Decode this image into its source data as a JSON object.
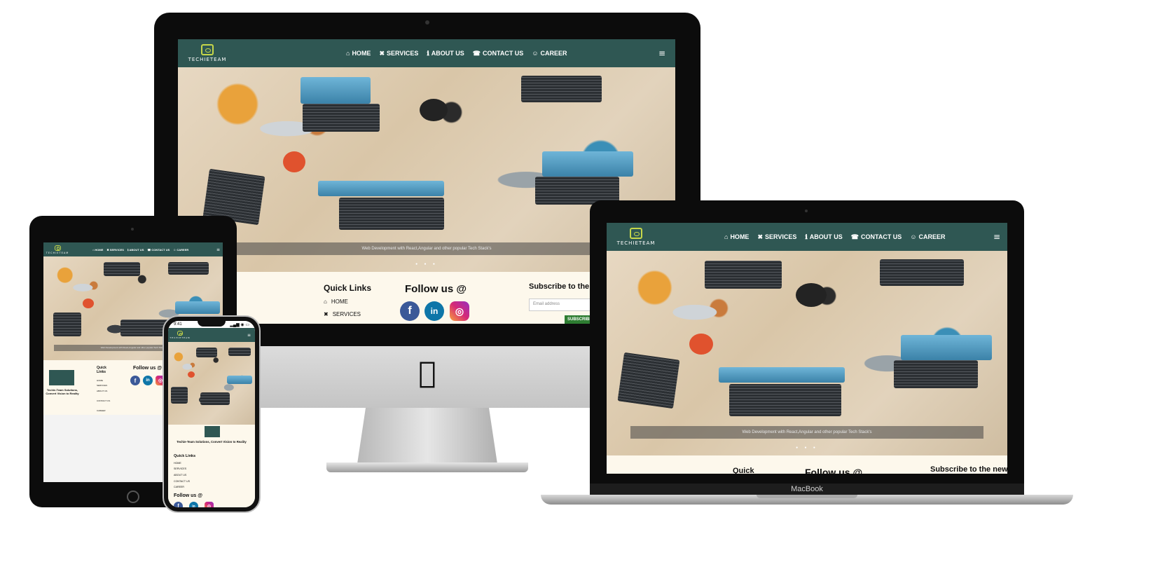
{
  "site": {
    "logo_text": "TECHIETEAM",
    "nav": [
      {
        "label": "HOME",
        "icon": "home-icon",
        "glyph": "⌂"
      },
      {
        "label": "SERVICES",
        "icon": "tools-icon",
        "glyph": "✖"
      },
      {
        "label": "ABOUT US",
        "icon": "info-icon",
        "glyph": "ℹ"
      },
      {
        "label": "CONTACT US",
        "icon": "phone-icon",
        "glyph": "☎"
      },
      {
        "label": "CAREER",
        "icon": "user-circle-icon",
        "glyph": "☺"
      }
    ],
    "menu_glyph": "≡",
    "hero_caption": "Web Development with React,Angular and other popular Tech Stack's",
    "carousel_dots": "● ● ●",
    "tagline": "Techie-Team Solutions, Convert Vision to Reality",
    "footer": {
      "quick_links_heading": "Quick Links",
      "follow_heading": "Follow us @",
      "subscribe_heading": "Subscribe to the newsletter",
      "email_placeholder": "Email address",
      "subscribe_button": "SUBSCRIBE",
      "social": [
        {
          "name": "facebook-icon",
          "glyph": "f"
        },
        {
          "name": "linkedin-icon",
          "glyph": "in"
        },
        {
          "name": "instagram-icon",
          "glyph": "◎"
        }
      ]
    }
  },
  "imac": {
    "quick_heading": "Quick Links",
    "follow_heading": "Follow us @",
    "subscribe_heading": "Subscribe to the",
    "email_placeholder": "Email address",
    "subscribe_button": "SUBSCRIBE",
    "links": [
      {
        "label": "HOME",
        "glyph": "⌂"
      },
      {
        "label": "SERVICES",
        "glyph": "✖"
      }
    ]
  },
  "macbook": {
    "quick_heading": "Quick",
    "follow_heading": "Follow us @",
    "subscribe_heading": "Subscribe to the new",
    "label": "MacBook"
  },
  "ipad": {
    "quick_heading": "Quick\nLinks",
    "follow_heading": "Follow us @",
    "tagline": "Techie-Team Solutions, Convert Vision to Reality",
    "links": [
      "HOME",
      "SERVICES",
      "ABOUT US",
      "CONTACT US",
      "CAREER"
    ]
  },
  "iphone": {
    "time": "9:41",
    "status": "▂▄▆ ◉ ▭",
    "tagline": "Techie-Team Solutions, Convert Vision to Reality",
    "quick_heading": "Quick Links",
    "follow_heading": "Follow us @",
    "links": [
      "HOME",
      "SERVICES",
      "ABOUT US",
      "CONTACT US",
      "CAREER"
    ]
  },
  "apple_glyph": ""
}
